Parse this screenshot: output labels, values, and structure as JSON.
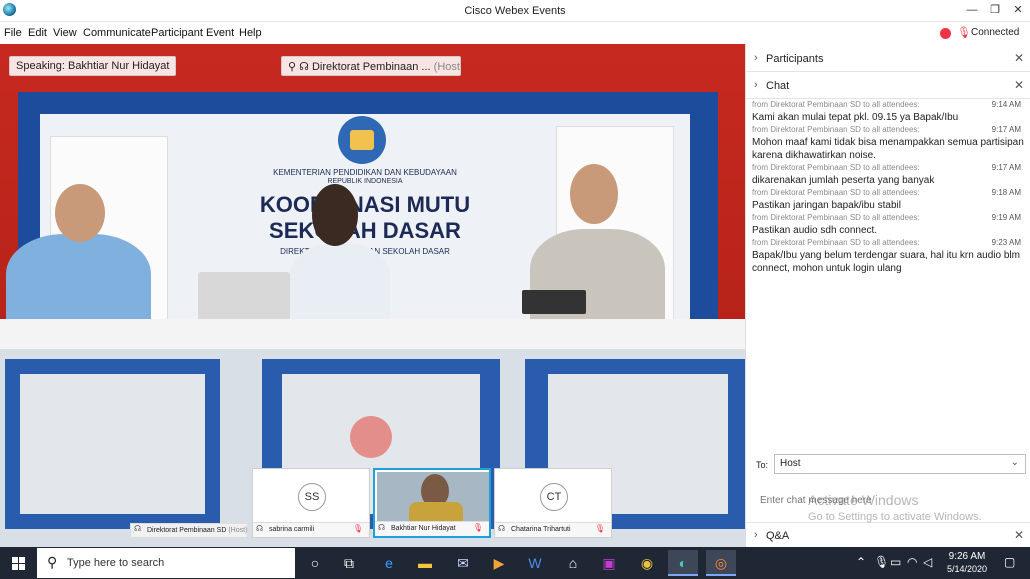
{
  "window": {
    "title": "Cisco Webex Events",
    "minimize": "—",
    "restore": "❐",
    "close": "✕"
  },
  "menu": [
    "File",
    "Edit",
    "View",
    "Communicate",
    "Participant",
    "Event",
    "Help"
  ],
  "status": {
    "text": "Connected",
    "color": "#e33e3e"
  },
  "video": {
    "wall_title_small": "KEMENTERIAN PENDIDIKAN DAN KEBUDAYAAN",
    "wall_title_small2": "REPUBLIK INDONESIA",
    "wall_line1": "KOORDINASI MUTU",
    "wall_line2": "SEKOLAH DASAR",
    "wall_line3": "DIREKTORAT PEMBINAAN SEKOLAH DASAR"
  },
  "overlay": {
    "speaking": "Speaking: Bakhtiar Nur Hidayat",
    "host_name": "Direktorat Pembinaan ...",
    "host_tag": "(Host)"
  },
  "thumbnails": [
    {
      "name": "Direktorat Pembinaan SD",
      "tag": "(Host)",
      "initials": "",
      "active": false
    },
    {
      "name": "sabrina carmili",
      "tag": "",
      "initials": "SS",
      "active": false
    },
    {
      "name": "Bakhtiar Nur Hidayat",
      "tag": "",
      "initials": "",
      "active": true
    },
    {
      "name": "Chatarina Trihartuti",
      "tag": "",
      "initials": "CT",
      "active": false
    }
  ],
  "panels": {
    "participants": "Participants",
    "chat": "Chat",
    "qa": "Q&A"
  },
  "chat": {
    "messages": [
      {
        "from": "from Direktorat Pembinaan SD to all attendees:",
        "time": "9:14 AM",
        "text": "Kami akan mulai tepat pkl. 09.15 ya Bapak/Ibu"
      },
      {
        "from": "from Direktorat Pembinaan SD to all attendees:",
        "time": "9:17 AM",
        "text": "Mohon maaf kami tidak bisa menampakkan semua partisipan karena dikhawatirkan noise."
      },
      {
        "from": "from Direktorat Pembinaan SD to all attendees:",
        "time": "9:17 AM",
        "text": "dikarenakan jumlah peserta yang banyak"
      },
      {
        "from": "from Direktorat Pembinaan SD to all attendees:",
        "time": "9:18 AM",
        "text": "Pastikan jaringan bapak/ibu stabil"
      },
      {
        "from": "from Direktorat Pembinaan SD to all attendees:",
        "time": "9:19 AM",
        "text": "Pastikan audio sdh connect."
      },
      {
        "from": "from Direktorat Pembinaan SD to all attendees:",
        "time": "9:23 AM",
        "text": "Bapak/Ibu yang belum terdengar suara, hal itu krn audio blm connect, mohon untuk login ulang"
      }
    ],
    "to_label": "To:",
    "to_value": "Host",
    "input_placeholder": "Enter chat message here"
  },
  "watermark": {
    "title": "Activate Windows",
    "subtitle": "Go to Settings to activate Windows."
  },
  "taskbar": {
    "search_placeholder": "Type here to search",
    "time": "9:26 AM",
    "date": "5/14/2020"
  }
}
